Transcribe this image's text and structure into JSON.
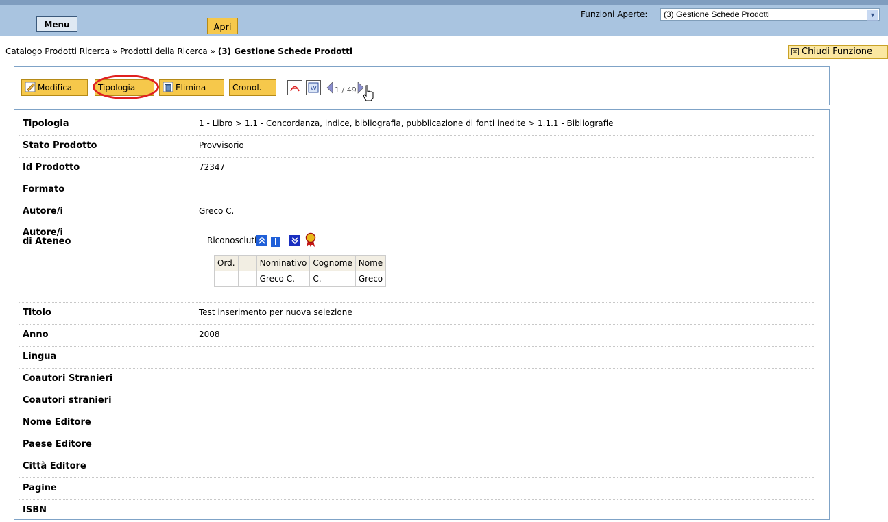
{
  "topbar": {
    "menu_label": "Menu",
    "apri_label": "Apri",
    "funzioni_label": "Funzioni Aperte:",
    "funzioni_selected": "(3) Gestione Schede Prodotti"
  },
  "breadcrumb": {
    "part1": "Catalogo Prodotti Ricerca",
    "sep": " » ",
    "part2": "Prodotti della Ricerca",
    "current": "(3) Gestione Schede Prodotti"
  },
  "chiudi_label": "Chiudi Funzione",
  "toolbar": {
    "modifica": "Modifica",
    "tipologia": "Tipologia",
    "elimina": "Elimina",
    "cronol": "Cronol.",
    "pager": "1 / 49"
  },
  "fields": {
    "tipologia": {
      "label": "Tipologia",
      "value": "1 - Libro > 1.1 - Concordanza, indice, bibliografia, pubblicazione di fonti inedite > 1.1.1 - Bibliografie"
    },
    "stato": {
      "label": "Stato Prodotto",
      "value": "Provvisorio"
    },
    "id": {
      "label": "Id Prodotto",
      "value": "72347"
    },
    "formato": {
      "label": "Formato",
      "value": ""
    },
    "autori": {
      "label": "Autore/i",
      "value": "Greco C."
    },
    "autori_ateneo": {
      "label_line1": "Autore/i",
      "label_line2": "di Ateneo"
    },
    "titolo": {
      "label": "Titolo",
      "value": "Test inserimento per nuova selezione"
    },
    "anno": {
      "label": "Anno",
      "value": "2008"
    },
    "lingua": {
      "label": "Lingua"
    },
    "coautori1": {
      "label": "Coautori Stranieri"
    },
    "coautori2": {
      "label": "Coautori stranieri"
    },
    "nome_editore": {
      "label": "Nome Editore"
    },
    "paese_editore": {
      "label": "Paese Editore"
    },
    "citta_editore": {
      "label": "Città Editore"
    },
    "pagine": {
      "label": "Pagine"
    },
    "isbn": {
      "label": "ISBN"
    }
  },
  "riconosciuti": "Riconosciuti: 1",
  "authors_table": {
    "headers": [
      "Ord.",
      "",
      "Nominativo",
      "Cognome",
      "Nome"
    ],
    "rows": [
      [
        "",
        "",
        "Greco C.",
        "C.",
        "Greco"
      ]
    ]
  }
}
